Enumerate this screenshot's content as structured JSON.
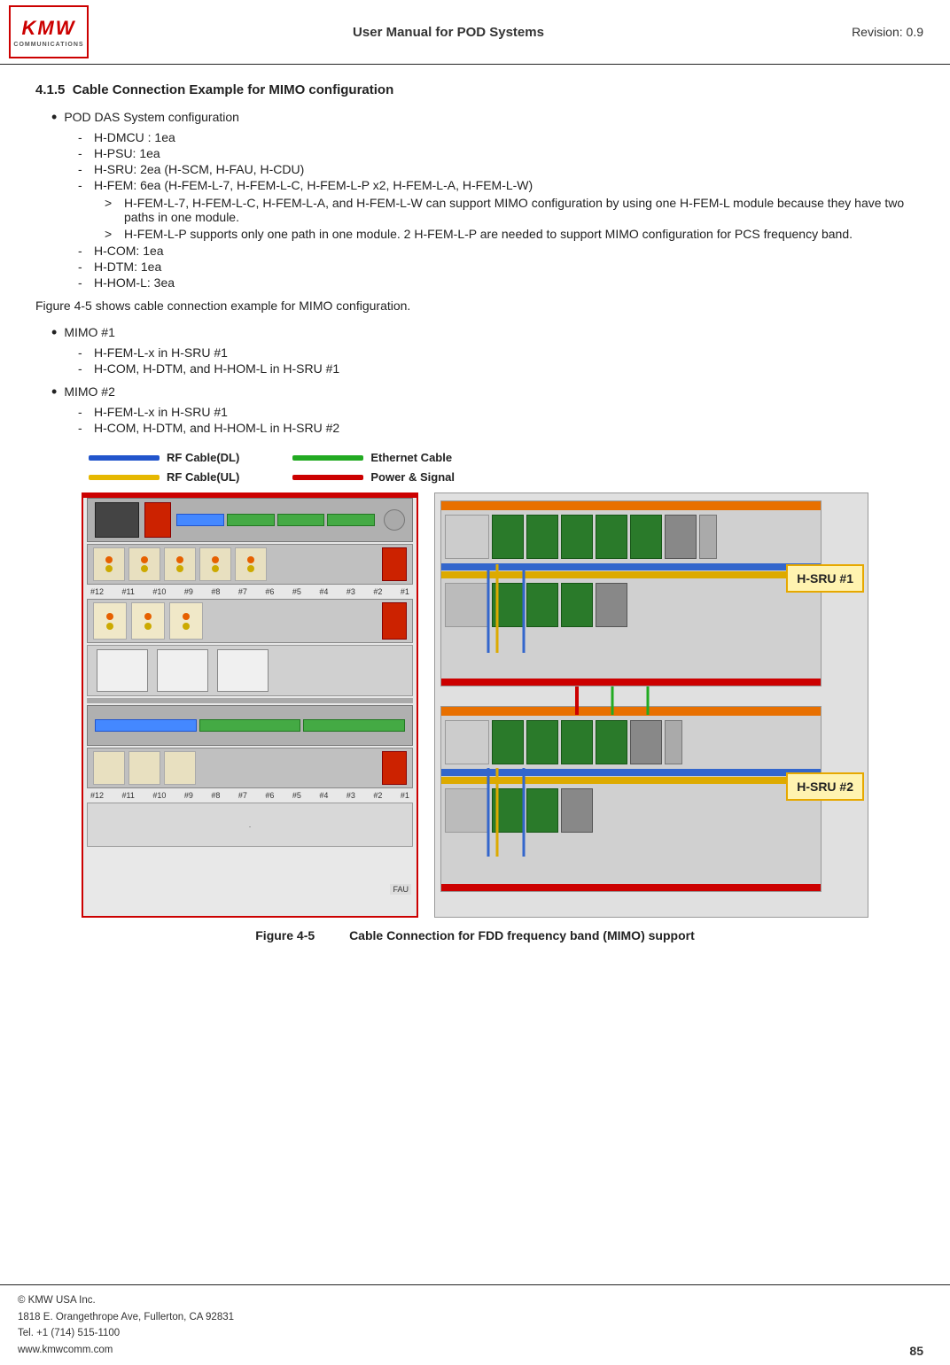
{
  "header": {
    "title": "User Manual for POD Systems",
    "revision": "Revision: 0.9",
    "logo_kmw": "KMW",
    "logo_sub": "COMMUNICATIONS"
  },
  "section": {
    "number": "4.1.5",
    "title": "Cable Connection Example for MIMO configuration"
  },
  "content": {
    "bullet1_label": "POD DAS System configuration",
    "dash_items": [
      "H-DMCU : 1ea",
      "H-PSU: 1ea",
      "H-SRU: 2ea (H-SCM, H-FAU, H-CDU)",
      "H-FEM: 6ea (H-FEM-L-7, H-FEM-L-C, H-FEM-L-P x2, H-FEM-L-A, H-FEM-L-W)"
    ],
    "sub_arrows": [
      "H-FEM-L-7, H-FEM-L-C, H-FEM-L-A, and H-FEM-L-W can support MIMO configuration by using one H-FEM-L module because they have two paths in one module.",
      "H-FEM-L-P supports only one path in one module. 2 H-FEM-L-P are needed to support MIMO configuration for PCS frequency band."
    ],
    "dash_items2": [
      "H-COM: 1ea",
      "H-DTM: 1ea",
      "H-HOM-L: 3ea"
    ],
    "figure_ref": "Figure 4-5 shows cable connection example for MIMO configuration.",
    "mimo1_label": "MIMO #1",
    "mimo1_dashes": [
      "H-FEM-L-x in H-SRU #1",
      "H-COM, H-DTM, and H-HOM-L in H-SRU #1"
    ],
    "mimo2_label": "MIMO #2",
    "mimo2_dashes": [
      "H-FEM-L-x in H-SRU #1",
      "H-COM, H-DTM, and H-HOM-L in H-SRU #2"
    ]
  },
  "legend": {
    "rf_dl_label": "RF Cable(DL)",
    "rf_ul_label": "RF Cable(UL)",
    "ethernet_label": "Ethernet Cable",
    "power_label": "Power & Signal"
  },
  "figure": {
    "number": "Figure 4-5",
    "caption": "Cable Connection for FDD frequency band (MIMO) support"
  },
  "sru_labels": {
    "sru1": "H-SRU #1",
    "sru2": "H-SRU #2"
  },
  "footer": {
    "company": "© KMW USA Inc.",
    "address": "1818 E. Orangethrope Ave, Fullerton, CA 92831",
    "tel": "Tel. +1 (714) 515-1100",
    "website": "www.kmwcomm.com",
    "page": "85"
  }
}
